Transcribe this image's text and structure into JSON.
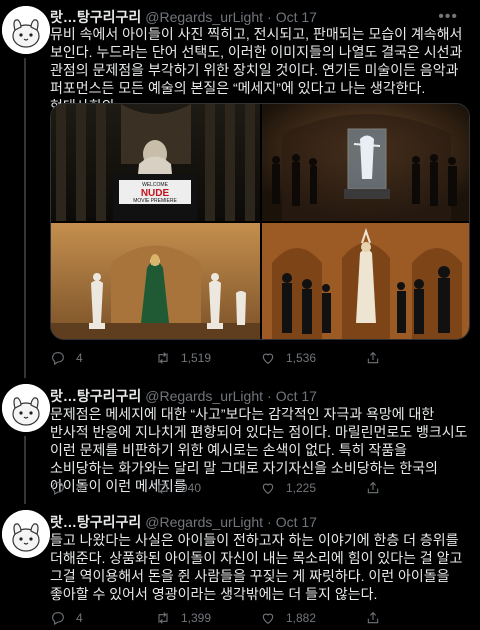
{
  "colors": {
    "background": "#000000",
    "text": "#e7e9ea",
    "muted": "#71767b",
    "divider": "#2f3336"
  },
  "tweets": [
    {
      "name": "랏…탕구리구리",
      "handle": "@Regards_urLight",
      "separator": "·",
      "time": "Oct 17",
      "text": "뮤비 속에서 아이들이 사진 찍히고, 전시되고, 판매되는 모습이 계속해서 보인다. 누드라는 단어 선택도, 이러한 이미지들의 나열도 결국은 시선과 관점의 문제점을 부각하기 위한 장치일 것이다. 연기든 미술이든 음악과 퍼포먼스든 모든 예술의 본질은 “메세지”에 있다고 나는 생각한다. 현대사회의",
      "media": {
        "images": [
          {
            "icon": "stage-podium-image",
            "sign_line1": "WELCOME",
            "sign_line2": "NUDE",
            "sign_line3": "MOVIE PREMIERE"
          },
          {
            "icon": "glass-display-case-image"
          },
          {
            "icon": "gallery-statues-image"
          },
          {
            "icon": "dancers-arches-image"
          }
        ]
      },
      "replies": "4",
      "retweets": "1,519",
      "likes": "1,536"
    },
    {
      "name": "랏…탕구리구리",
      "handle": "@Regards_urLight",
      "separator": "·",
      "time": "Oct 17",
      "text": "문제점은 메세지에 대한 “사고”보다는 감각적인 자극과 욕망에 대한 반사적 반응에 지나치게 편향되어 있다는 점이다. 마릴린먼로도 뱅크시도 이런 문제를 비판하기 위한 예시로는 손색이 없다. 특히 작품을 소비당하는 화가와는 달리 말 그대로 자기자신을 소비당하는 한국의 아이돌이 이런 메세지를",
      "replies": "4",
      "retweets": "940",
      "likes": "1,225"
    },
    {
      "name": "랏…탕구리구리",
      "handle": "@Regards_urLight",
      "separator": "·",
      "time": "Oct 17",
      "text": "들고 나왔다는 사실은 아이들이 전하고자 하는 이야기에 한층 더 층위를 더해준다. 상품화된 아이돌이 자신이 내는 목소리에 힘이 있다는 걸 알고 그걸 역이용해서 돈을 쥔 사람들을 꾸짖는 게 짜릿하다. 이런 아이돌을 좋아할 수 있어서 영광이라는 생각밖에는 더 들지 않는다.",
      "replies": "4",
      "retweets": "1,399",
      "likes": "1,882"
    }
  ]
}
